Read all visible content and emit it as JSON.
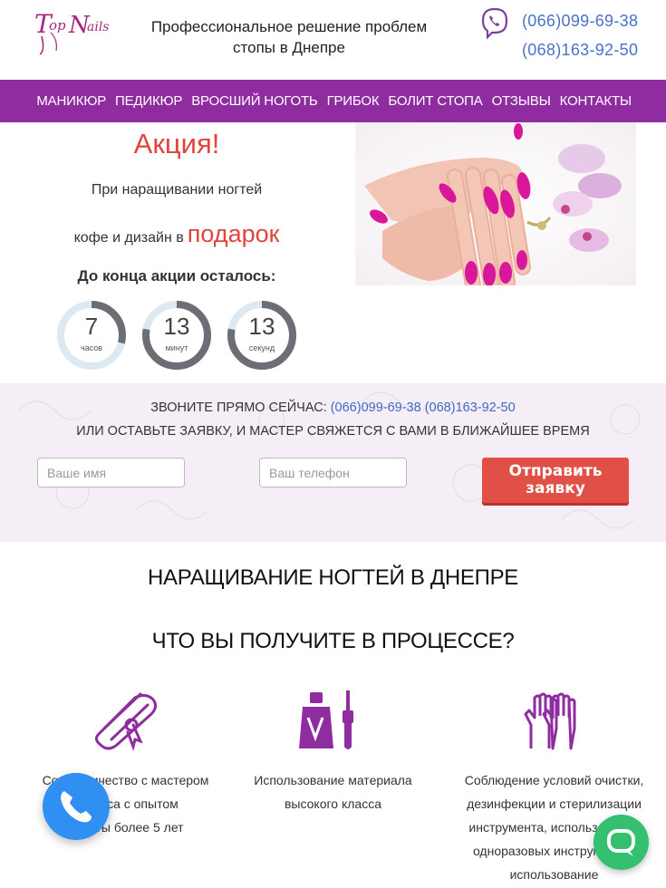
{
  "header": {
    "logo_text": "TopNails",
    "tagline_line1": "Профессиональное решение проблем",
    "tagline_line2": "стопы в Днепре",
    "phone1": "(066)099-69-38",
    "phone2": "(068)163-92-50"
  },
  "nav": {
    "items": [
      {
        "label": "МАНИКЮР"
      },
      {
        "label": "ПЕДИКЮР"
      },
      {
        "label": "ВРОСШИЙ НОГОТЬ"
      },
      {
        "label": "ГРИБОК"
      },
      {
        "label": "БОЛИТ СТОПА"
      },
      {
        "label": "ОТЗЫВЫ"
      },
      {
        "label": "КОНТАКТЫ"
      }
    ]
  },
  "promo": {
    "title": "Акция!",
    "line1": "При наращивании ногтей",
    "line2": "кофе и дизайн в",
    "gift": "подарок",
    "countdown_title": "До конца акции осталось:",
    "timers": [
      {
        "value": "7",
        "unit": "часов",
        "fraction": 0.29
      },
      {
        "value": "13",
        "unit": "минут",
        "fraction": 0.78
      },
      {
        "value": "13",
        "unit": "секунд",
        "fraction": 0.78
      }
    ]
  },
  "form": {
    "call_now": "ЗВОНИТЕ ПРЯМО СЕЙЧАС:",
    "phone1": "(066)099-69-38",
    "phone2": "(068)163-92-50",
    "or_leave": "ИЛИ ОСТАВЬТЕ ЗАЯВКУ, И МАСТЕР СВЯЖЕТСЯ С ВАМИ В БЛИЖАЙШЕЕ ВРЕМЯ",
    "name_placeholder": "Ваше имя",
    "phone_placeholder": "Ваш телефон",
    "submit_line1": "Отправить",
    "submit_line2": "заявку"
  },
  "sections": {
    "title1": "НАРАЩИВАНИЕ НОГТЕЙ В ДНЕПРЕ",
    "title2": "ЧТО ВЫ ПОЛУЧИТЕ В ПРОЦЕССЕ?"
  },
  "features": [
    {
      "icon": "diploma-icon",
      "lines": [
        "Сотрудничество с мастером",
        "сервиса с опытом",
        "работы более 5 лет"
      ]
    },
    {
      "icon": "nail-polish-icon",
      "lines": [
        "Использование материала",
        "высокого класса"
      ]
    },
    {
      "icon": "gloves-icon",
      "lines": [
        "Соблюдение условий очистки,",
        "дезинфекции и стерилизации",
        "инструмента, использование",
        "одноразовых инструментов",
        "использование"
      ]
    }
  ],
  "colors": {
    "brand_purple": "#8f2da0",
    "accent_red": "#e0443c",
    "link_blue": "#4a72c8",
    "chat_green": "#35c06f",
    "call_blue": "#2f8ff2"
  }
}
